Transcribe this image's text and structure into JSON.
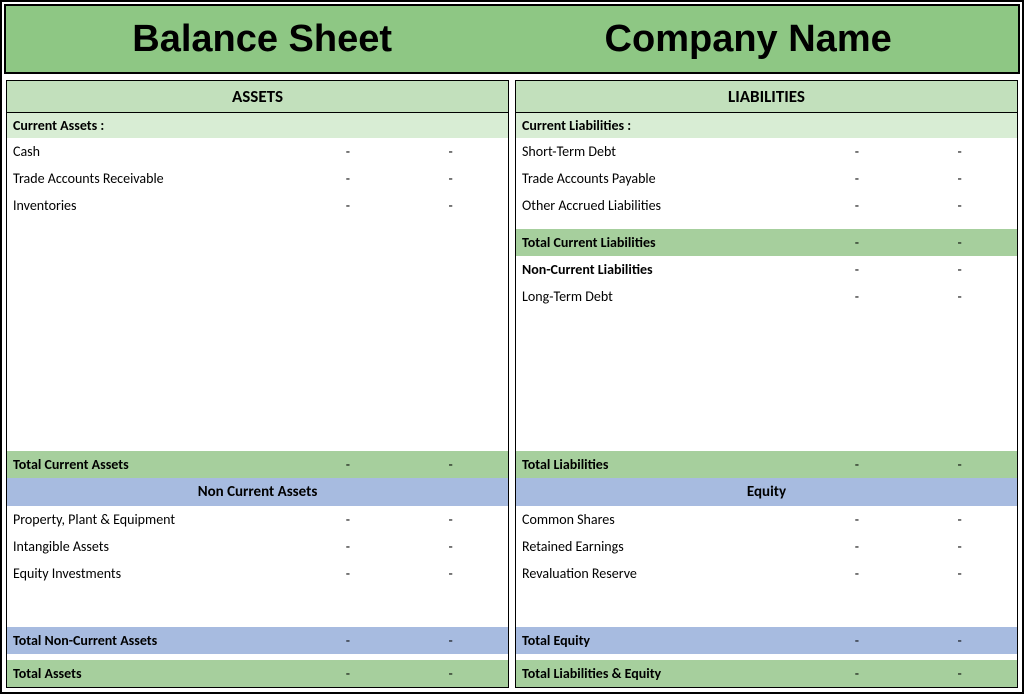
{
  "header": {
    "title_left": "Balance Sheet",
    "title_right": "Company Name"
  },
  "assets": {
    "header": "ASSETS",
    "current_label": "Current Assets :",
    "items": [
      {
        "label": "Cash",
        "v1": "-",
        "v2": "-"
      },
      {
        "label": "Trade Accounts Receivable",
        "v1": "-",
        "v2": "-"
      },
      {
        "label": "Inventories",
        "v1": "-",
        "v2": "-"
      }
    ],
    "total_current": {
      "label": "Total Current Assets",
      "v1": "-",
      "v2": "-"
    },
    "noncurrent_header": "Non Current Assets",
    "noncurrent_items": [
      {
        "label": "Property, Plant & Equipment",
        "v1": "-",
        "v2": "-"
      },
      {
        "label": "Intangible Assets",
        "v1": "-",
        "v2": "-"
      },
      {
        "label": "Equity Investments",
        "v1": "-",
        "v2": "-"
      }
    ],
    "total_noncurrent": {
      "label": "Total Non-Current Assets",
      "v1": "-",
      "v2": "-"
    },
    "total_assets": {
      "label": "Total Assets",
      "v1": "-",
      "v2": "-"
    }
  },
  "liabilities": {
    "header": "LIABILITIES",
    "current_label": "Current Liabilities :",
    "items": [
      {
        "label": "Short-Term Debt",
        "v1": "-",
        "v2": "-"
      },
      {
        "label": "Trade Accounts Payable",
        "v1": "-",
        "v2": "-"
      },
      {
        "label": "Other Accrued Liabilities",
        "v1": "-",
        "v2": "-"
      }
    ],
    "total_current": {
      "label": "Total Current Liabilities",
      "v1": "-",
      "v2": "-"
    },
    "noncurrent_label": "Non-Current Liabilities",
    "noncurrent_v1": "-",
    "noncurrent_v2": "-",
    "noncurrent_items": [
      {
        "label": "Long-Term Debt",
        "v1": "-",
        "v2": "-"
      }
    ],
    "total_liabilities": {
      "label": "Total Liabilities",
      "v1": "-",
      "v2": "-"
    },
    "equity_header": "Equity",
    "equity_items": [
      {
        "label": "Common Shares",
        "v1": "-",
        "v2": "-"
      },
      {
        "label": "Retained Earnings",
        "v1": "-",
        "v2": "-"
      },
      {
        "label": "Revaluation Reserve",
        "v1": "-",
        "v2": "-"
      }
    ],
    "total_equity": {
      "label": "Total Equity",
      "v1": "-",
      "v2": "-"
    },
    "total_liab_equity": {
      "label": "Total Liabilities & Equity",
      "v1": "-",
      "v2": "-"
    }
  }
}
